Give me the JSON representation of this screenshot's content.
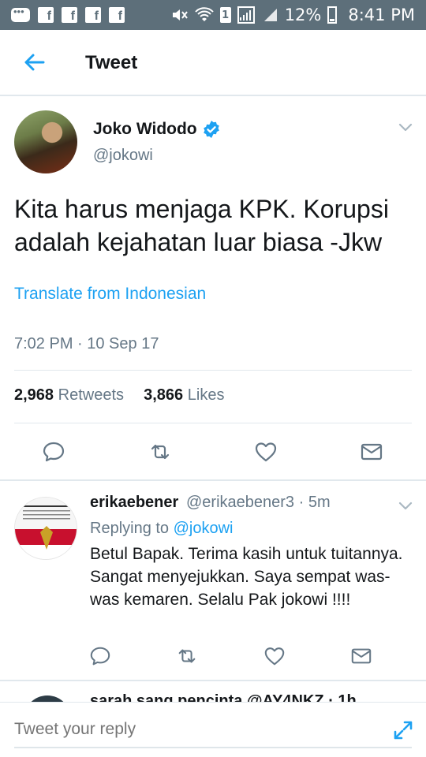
{
  "status_bar": {
    "battery": "12%",
    "time": "8:41 PM",
    "sim_slot": "1",
    "fb_glyph": "f"
  },
  "header": {
    "title": "Tweet"
  },
  "tweet": {
    "author_name": "Joko Widodo",
    "author_handle": "@jokowi",
    "text": "Kita harus menjaga KPK. Korupsi adalah kejahatan luar biasa -Jkw",
    "translate_label": "Translate from Indonesian",
    "timestamp": "7:02 PM · 10 Sep 17",
    "retweets_count": "2,968",
    "retweets_label": "Retweets",
    "likes_count": "3,866",
    "likes_label": "Likes"
  },
  "reply": {
    "author_name": "erikaebener",
    "author_handle": "@erikaebener3 · 5m",
    "replying_prefix": "Replying to",
    "replying_to": "@jokowi",
    "text": "Betul Bapak. Terima kasih untuk tuitannya. Sangat menyejukkan. Saya sempat was-was kemaren. Selalu Pak jokowi !!!!"
  },
  "next_reply": {
    "partial_text": "sarah sang pencinta @AY4NKZ · 1h"
  },
  "reply_bar": {
    "placeholder": "Tweet your reply"
  },
  "colors": {
    "accent": "#1da1f2",
    "status_bar": "#5d6f7a",
    "secondary_text": "#657786",
    "divider": "#e1e8ed"
  }
}
